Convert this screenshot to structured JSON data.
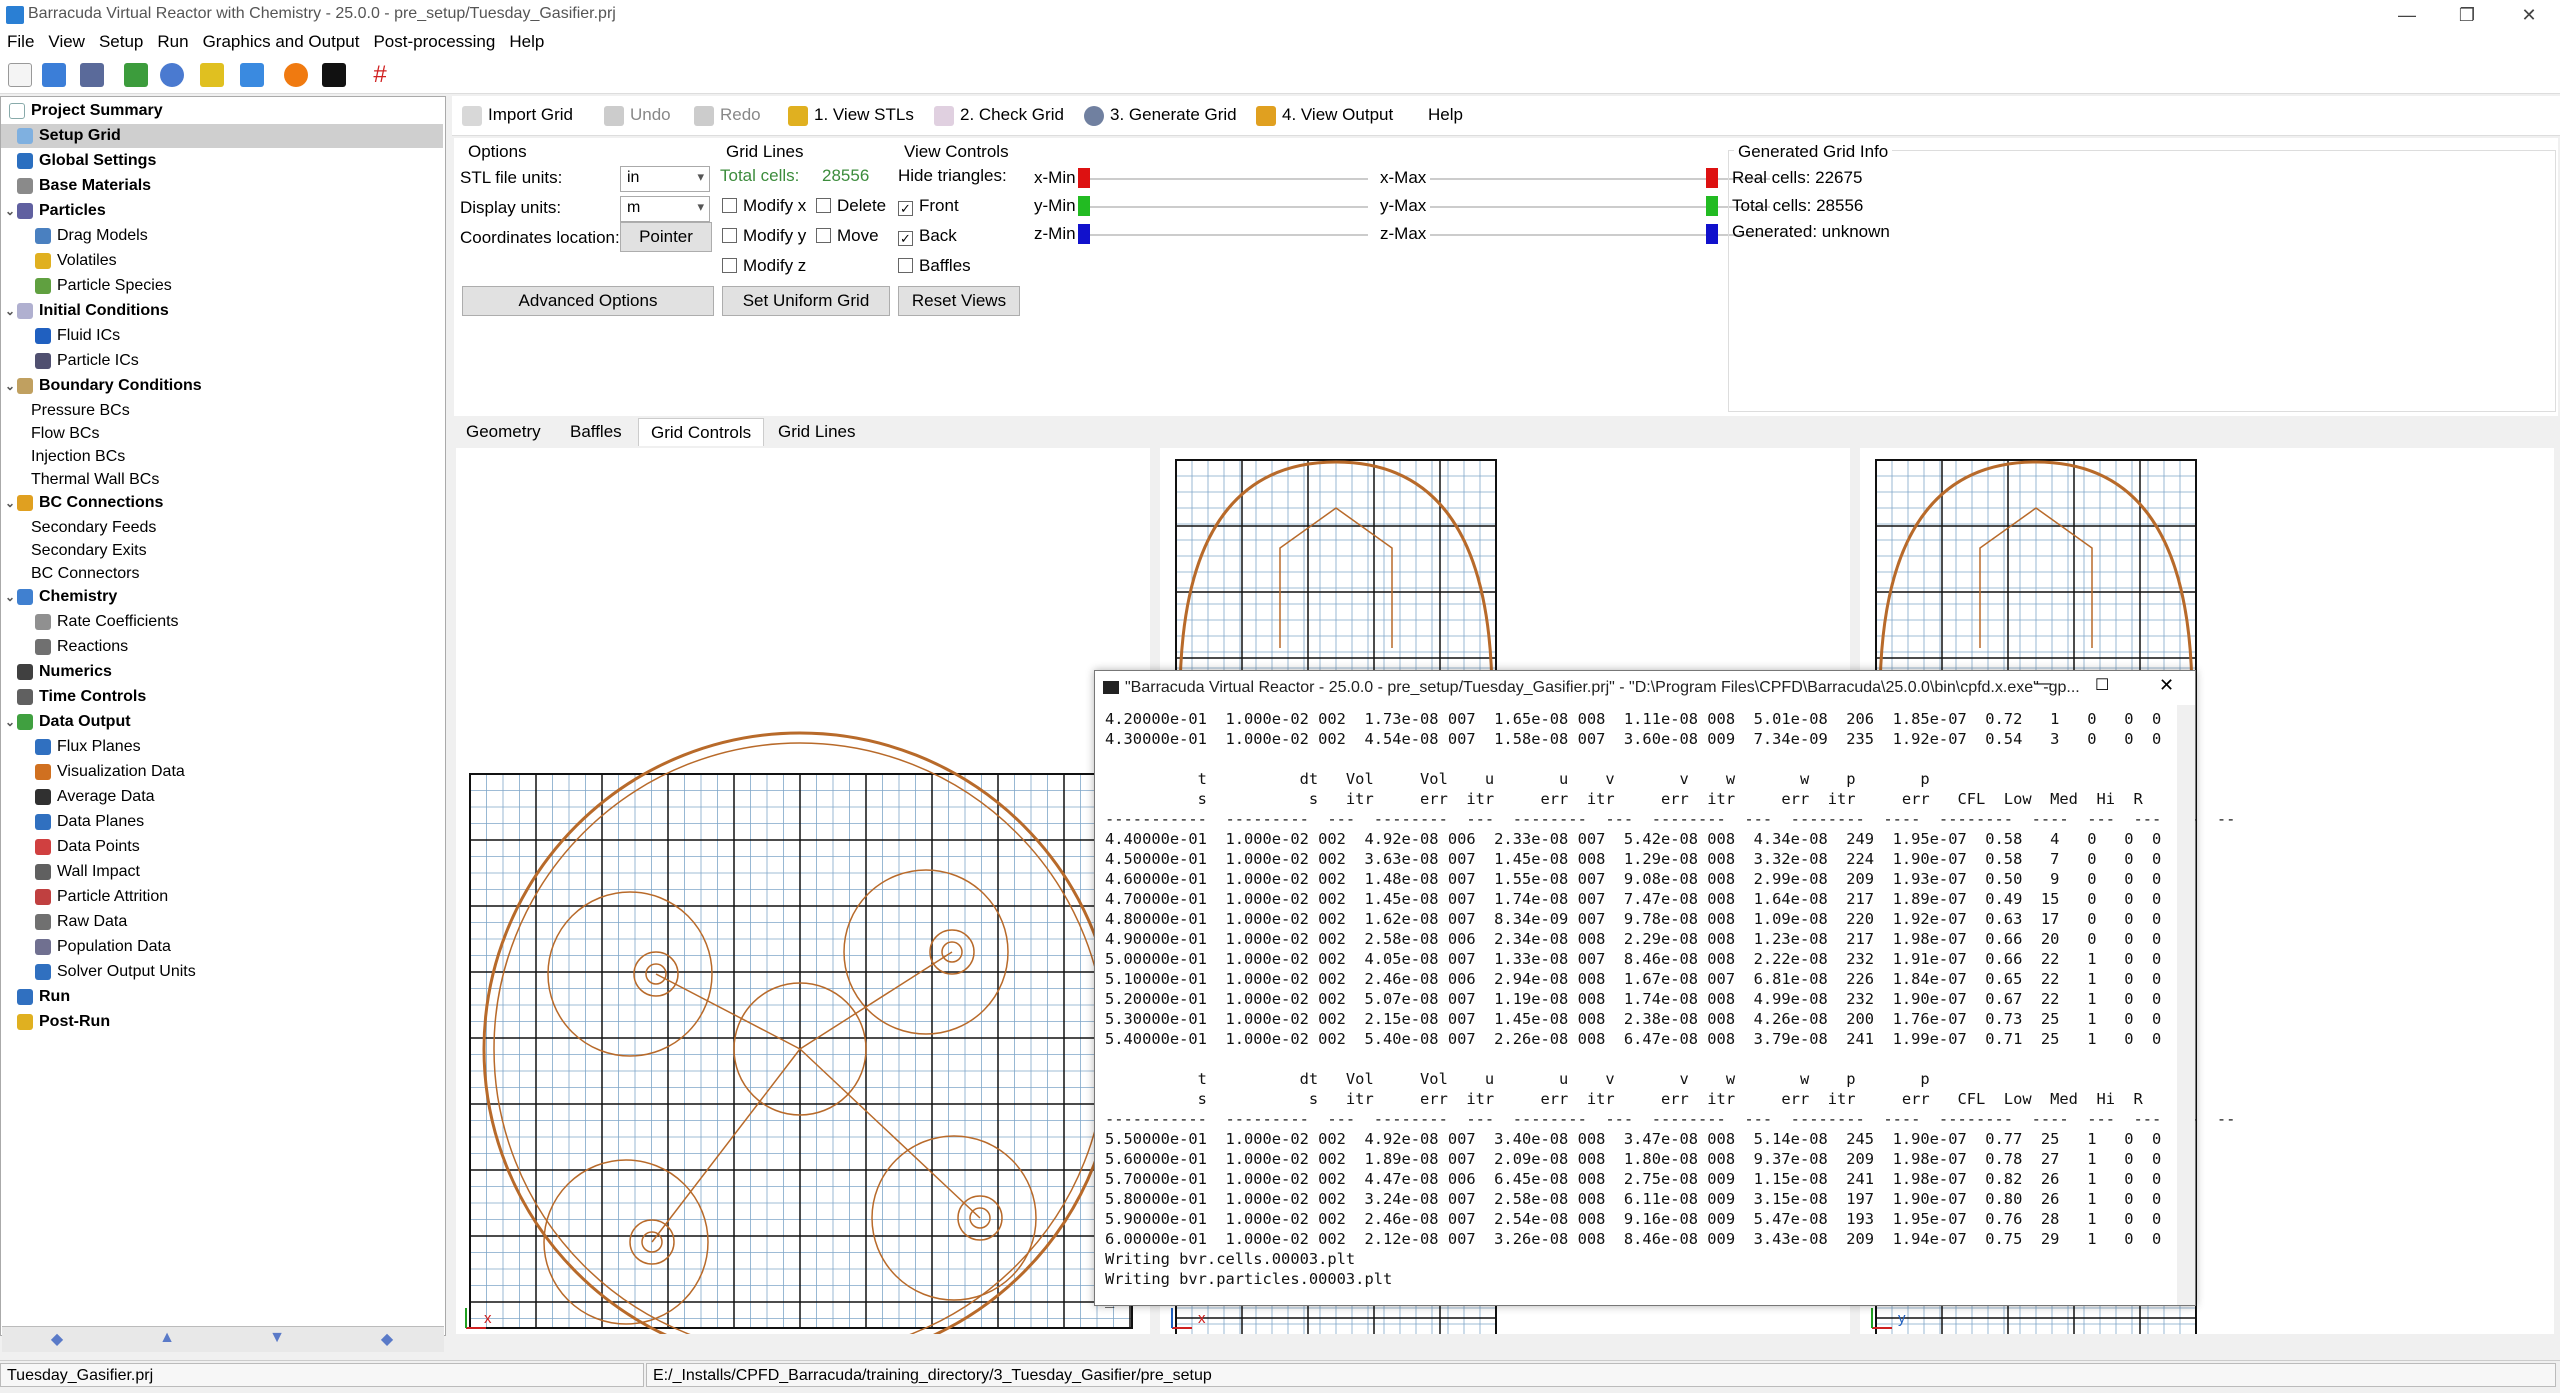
{
  "window": {
    "title": "Barracuda Virtual Reactor with Chemistry - 25.0.0 - pre_setup/Tuesday_Gasifier.prj",
    "minimize": "—",
    "maximize": "❐",
    "close": "✕"
  },
  "menu": [
    "File",
    "View",
    "Setup",
    "Run",
    "Graphics and Output",
    "Post-processing",
    "Help"
  ],
  "tree": [
    {
      "label": "Project Summary",
      "bold": true,
      "icon": "project-icon",
      "color": "#ffffff"
    },
    {
      "label": "Setup Grid",
      "bold": true,
      "icon": "grid-icon",
      "color": "#7fb0e0"
    },
    {
      "label": "Global Settings",
      "bold": true,
      "icon": "globe-icon",
      "color": "#2b6fc0"
    },
    {
      "label": "Base Materials",
      "bold": true,
      "icon": "gear-icon",
      "color": "#8a8a8a"
    },
    {
      "label": "Particles",
      "bold": true,
      "icon": "particles-icon",
      "color": "#6060a0"
    },
    {
      "label": "Drag Models",
      "bold": false,
      "icon": "drag-icon",
      "color": "#4a80c0"
    },
    {
      "label": "Volatiles",
      "bold": false,
      "icon": "volatiles-icon",
      "color": "#e0b020"
    },
    {
      "label": "Particle Species",
      "bold": false,
      "icon": "species-icon",
      "color": "#60a040"
    },
    {
      "label": "Initial Conditions",
      "bold": true,
      "icon": "ic-icon",
      "color": "#b0b0d0"
    },
    {
      "label": "Fluid ICs",
      "bold": false,
      "icon": "fluid-ic-icon",
      "color": "#2060c0"
    },
    {
      "label": "Particle ICs",
      "bold": false,
      "icon": "particle-ic-icon",
      "color": "#505070"
    },
    {
      "label": "Boundary Conditions",
      "bold": true,
      "icon": "bc-icon",
      "color": "#c0a060"
    },
    {
      "label": "Pressure BCs",
      "bold": false,
      "icon": "",
      "color": ""
    },
    {
      "label": "Flow BCs",
      "bold": false,
      "icon": "",
      "color": ""
    },
    {
      "label": "Injection BCs",
      "bold": false,
      "icon": "",
      "color": ""
    },
    {
      "label": "Thermal Wall BCs",
      "bold": false,
      "icon": "",
      "color": ""
    },
    {
      "label": "BC Connections",
      "bold": true,
      "icon": "connections-icon",
      "color": "#e0a020"
    },
    {
      "label": "Secondary Feeds",
      "bold": false,
      "icon": "",
      "color": ""
    },
    {
      "label": "Secondary Exits",
      "bold": false,
      "icon": "",
      "color": ""
    },
    {
      "label": "BC Connectors",
      "bold": false,
      "icon": "",
      "color": ""
    },
    {
      "label": "Chemistry",
      "bold": true,
      "icon": "flask-icon",
      "color": "#4080d0"
    },
    {
      "label": "Rate Coefficients",
      "bold": false,
      "icon": "table-icon",
      "color": "#909090"
    },
    {
      "label": "Reactions",
      "bold": false,
      "icon": "reactions-icon",
      "color": "#707070"
    },
    {
      "label": "Numerics",
      "bold": true,
      "icon": "numerics-icon",
      "color": "#404040"
    },
    {
      "label": "Time Controls",
      "bold": true,
      "icon": "clock-icon",
      "color": "#606060"
    },
    {
      "label": "Data Output",
      "bold": true,
      "icon": "output-icon",
      "color": "#40a040"
    },
    {
      "label": "Flux Planes",
      "bold": false,
      "icon": "flux-icon",
      "color": "#3070c0"
    },
    {
      "label": "Visualization Data",
      "bold": false,
      "icon": "viz-icon",
      "color": "#d07020"
    },
    {
      "label": "Average Data",
      "bold": false,
      "icon": "sum-icon",
      "color": "#303030"
    },
    {
      "label": "Data Planes",
      "bold": false,
      "icon": "planes-icon",
      "color": "#3070c0"
    },
    {
      "label": "Data Points",
      "bold": false,
      "icon": "points-icon",
      "color": "#d04040"
    },
    {
      "label": "Wall Impact",
      "bold": false,
      "icon": "wall-icon",
      "color": "#606060"
    },
    {
      "label": "Particle Attrition",
      "bold": false,
      "icon": "attrition-icon",
      "color": "#c04040"
    },
    {
      "label": "Raw Data",
      "bold": false,
      "icon": "raw-icon",
      "color": "#707070"
    },
    {
      "label": "Population Data",
      "bold": false,
      "icon": "population-icon",
      "color": "#707090"
    },
    {
      "label": "Solver Output Units",
      "bold": false,
      "icon": "units-icon",
      "color": "#3070c0"
    },
    {
      "label": "Run",
      "bold": true,
      "icon": "run-icon",
      "color": "#3070c0"
    },
    {
      "label": "Post-Run",
      "bold": true,
      "icon": "postrun-icon",
      "color": "#e0b020"
    }
  ],
  "nav": [
    "◆",
    "▲",
    "▼",
    "◆"
  ],
  "toolbar2": {
    "import_grid": "Import Grid",
    "undo": "Undo",
    "redo": "Redo",
    "view_stls": "1. View STLs",
    "check_grid": "2. Check Grid",
    "generate_grid": "3. Generate Grid",
    "view_output": "4. View Output",
    "help": "Help"
  },
  "options": {
    "title": "Options",
    "stl_units_label": "STL file units:",
    "stl_units_value": "in",
    "display_units_label": "Display units:",
    "display_units_value": "m",
    "coords_label": "Coordinates location:",
    "coords_button": "Pointer",
    "advanced": "Advanced Options"
  },
  "grid_lines": {
    "title": "Grid Lines",
    "total_cells_label": "Total cells:",
    "total_cells_value": "28556",
    "modify_x": "Modify x",
    "modify_y": "Modify y",
    "modify_z": "Modify z",
    "delete": "Delete",
    "move": "Move",
    "uniform": "Set Uniform Grid"
  },
  "view_controls": {
    "title": "View Controls",
    "hide_triangles": "Hide triangles:",
    "front": "Front",
    "back": "Back",
    "baffles": "Baffles",
    "reset": "Reset Views",
    "xmin": "x-Min",
    "xmax": "x-Max",
    "ymin": "y-Min",
    "ymax": "y-Max",
    "zmin": "z-Min",
    "zmax": "z-Max",
    "x_color": "#dd1111",
    "y_color": "#22bb22",
    "z_color": "#1111cc"
  },
  "grid_info": {
    "title": "Generated Grid Info",
    "real_cells": "Real cells:  22675",
    "total_cells": "Total cells: 28556",
    "generated": "Generated: unknown"
  },
  "tabs": [
    "Geometry",
    "Baffles",
    "Grid Controls",
    "Grid Lines"
  ],
  "axes": {
    "x": "x",
    "y": "y",
    "z": "z"
  },
  "console": {
    "title": "\"Barracuda Virtual Reactor - 25.0.0 - pre_setup/Tuesday_Gasifier.prj\" - \"D:\\Program Files\\CPFD\\Barracuda\\25.0.0\\bin\\cpfd.x.exe\" -gp...",
    "text": "4.20000e-01  1.000e-02 002  1.73e-08 007  1.65e-08 008  1.11e-08 008  5.01e-08  206  1.85e-07  0.72   1   0   0  0\n4.30000e-01  1.000e-02 002  4.54e-08 007  1.58e-08 007  3.60e-08 009  7.34e-09  235  1.92e-07  0.54   3   0   0  0\n\n          t          dt   Vol     Vol    u       u    v       v    w       w    p       p\n          s           s   itr     err  itr     err  itr     err  itr     err  itr     err   CFL  Low  Med  Hi  R\n-----------  ---------  ---  --------  ---  --------  ---  --------  ---  --------  ----  --------  ----  ---  ---  --  --\n4.40000e-01  1.000e-02 002  4.92e-08 006  2.33e-08 007  5.42e-08 008  4.34e-08  249  1.95e-07  0.58   4   0   0  0\n4.50000e-01  1.000e-02 002  3.63e-08 007  1.45e-08 008  1.29e-08 008  3.32e-08  224  1.90e-07  0.58   7   0   0  0\n4.60000e-01  1.000e-02 002  1.48e-08 007  1.55e-08 007  9.08e-08 008  2.99e-08  209  1.93e-07  0.50   9   0   0  0\n4.70000e-01  1.000e-02 002  1.45e-08 007  1.74e-08 007  7.47e-08 008  1.64e-08  217  1.89e-07  0.49  15   0   0  0\n4.80000e-01  1.000e-02 002  1.62e-08 007  8.34e-09 007  9.78e-08 008  1.09e-08  220  1.92e-07  0.63  17   0   0  0\n4.90000e-01  1.000e-02 002  2.58e-08 006  2.34e-08 008  2.29e-08 008  1.23e-08  217  1.98e-07  0.66  20   0   0  0\n5.00000e-01  1.000e-02 002  4.05e-08 007  1.33e-08 007  8.46e-08 008  2.22e-08  232  1.91e-07  0.66  22   1   0  0\n5.10000e-01  1.000e-02 002  2.46e-08 006  2.94e-08 008  1.67e-08 007  6.81e-08  226  1.84e-07  0.65  22   1   0  0\n5.20000e-01  1.000e-02 002  5.07e-08 007  1.19e-08 008  1.74e-08 008  4.99e-08  232  1.90e-07  0.67  22   1   0  0\n5.30000e-01  1.000e-02 002  2.15e-08 007  1.45e-08 008  2.38e-08 008  4.26e-08  200  1.76e-07  0.73  25   1   0  0\n5.40000e-01  1.000e-02 002  5.40e-08 007  2.26e-08 008  6.47e-08 008  3.79e-08  241  1.99e-07  0.71  25   1   0  0\n\n          t          dt   Vol     Vol    u       u    v       v    w       w    p       p\n          s           s   itr     err  itr     err  itr     err  itr     err  itr     err   CFL  Low  Med  Hi  R\n-----------  ---------  ---  --------  ---  --------  ---  --------  ---  --------  ----  --------  ----  ---  ---  --  --\n5.50000e-01  1.000e-02 002  4.92e-08 007  3.40e-08 008  3.47e-08 008  5.14e-08  245  1.90e-07  0.77  25   1   0  0\n5.60000e-01  1.000e-02 002  1.89e-08 007  2.09e-08 008  1.80e-08 008  9.37e-08  209  1.98e-07  0.78  27   1   0  0\n5.70000e-01  1.000e-02 002  4.47e-08 006  6.45e-08 008  2.75e-08 009  1.15e-08  241  1.98e-07  0.82  26   1   0  0\n5.80000e-01  1.000e-02 002  3.24e-08 007  2.58e-08 008  6.11e-08 009  3.15e-08  197  1.90e-07  0.80  26   1   0  0\n5.90000e-01  1.000e-02 002  2.46e-08 007  2.54e-08 008  9.16e-08 009  5.47e-08  193  1.95e-07  0.76  28   1   0  0\n6.00000e-01  1.000e-02 002  2.12e-08 007  3.26e-08 008  8.46e-08 009  3.43e-08  209  1.94e-07  0.75  29   1   0  0\nWriting bvr.cells.00003.plt\nWriting bvr.particles.00003.plt\n_"
  },
  "status": {
    "project": "Tuesday_Gasifier.prj",
    "path": "E:/_Installs/CPFD_Barracuda/training_directory/3_Tuesday_Gasifier/pre_setup"
  }
}
